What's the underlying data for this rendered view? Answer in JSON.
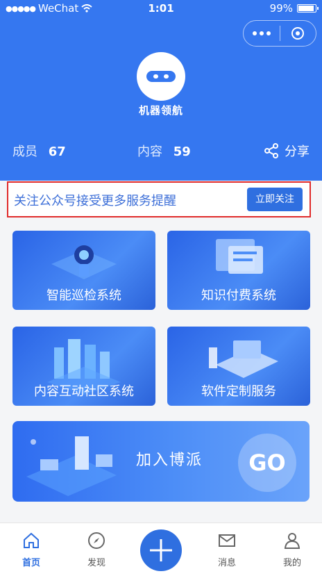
{
  "status_bar": {
    "carrier": "WeChat",
    "time": "1:01",
    "battery": "99%"
  },
  "brand": {
    "name": "机器领航"
  },
  "stats": {
    "members_label": "成员",
    "members_value": "67",
    "content_label": "内容",
    "content_value": "59",
    "share_label": "分享"
  },
  "follow_bar": {
    "text": "关注公众号接受更多服务提醒",
    "button_label": "立即关注"
  },
  "cards": [
    {
      "label": "智能巡检系统"
    },
    {
      "label": "知识付费系统"
    },
    {
      "label": "内容互动社区系统"
    },
    {
      "label": "软件定制服务"
    }
  ],
  "banner": {
    "title": "加入博派",
    "go": "GO"
  },
  "tabbar": [
    {
      "label": "首页",
      "icon": "home-icon",
      "active": true
    },
    {
      "label": "发现",
      "icon": "compass-icon"
    },
    {
      "label": "消息",
      "icon": "mail-icon"
    },
    {
      "label": "我的",
      "icon": "user-icon"
    }
  ],
  "colors": {
    "primary": "#3577f0",
    "highlight_border": "#e02b2b",
    "link_text": "#3d6fd8"
  }
}
